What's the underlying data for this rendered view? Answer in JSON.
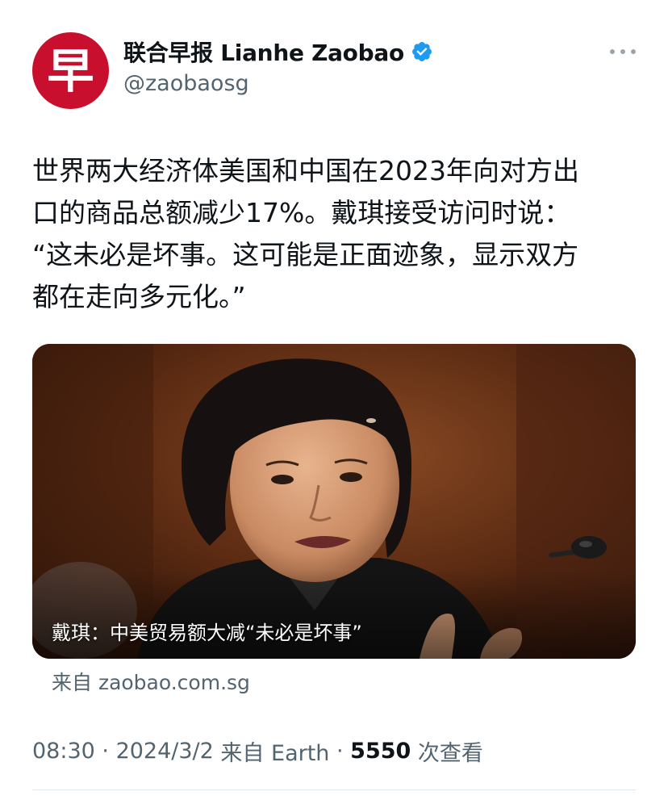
{
  "account": {
    "avatar_glyph": "早",
    "display_name": "联合早报 Lianhe Zaobao",
    "handle": "@zaobaosg",
    "avatar_color": "#c8102e",
    "verified_color": "#1d9bf0"
  },
  "tweet": {
    "text": "世界两大经济体美国和中国在2023年向对方出\n口的商品总额减少17%。戴琪接受访问时说：\n“这未必是坏事。这可能是正面迹象，显示双方\n都在走向多元化。”"
  },
  "media": {
    "caption": "戴琪：中美贸易额大减“未必是坏事”"
  },
  "link_source": "来自 zaobao.com.sg",
  "meta": {
    "time": "08:30",
    "date": "2024/3/2",
    "source_label": "来自 Earth",
    "views": "5550",
    "views_label": "次查看",
    "separator": " · "
  },
  "icons": {
    "verified": "verified-badge-icon",
    "more": "more-options-icon"
  }
}
